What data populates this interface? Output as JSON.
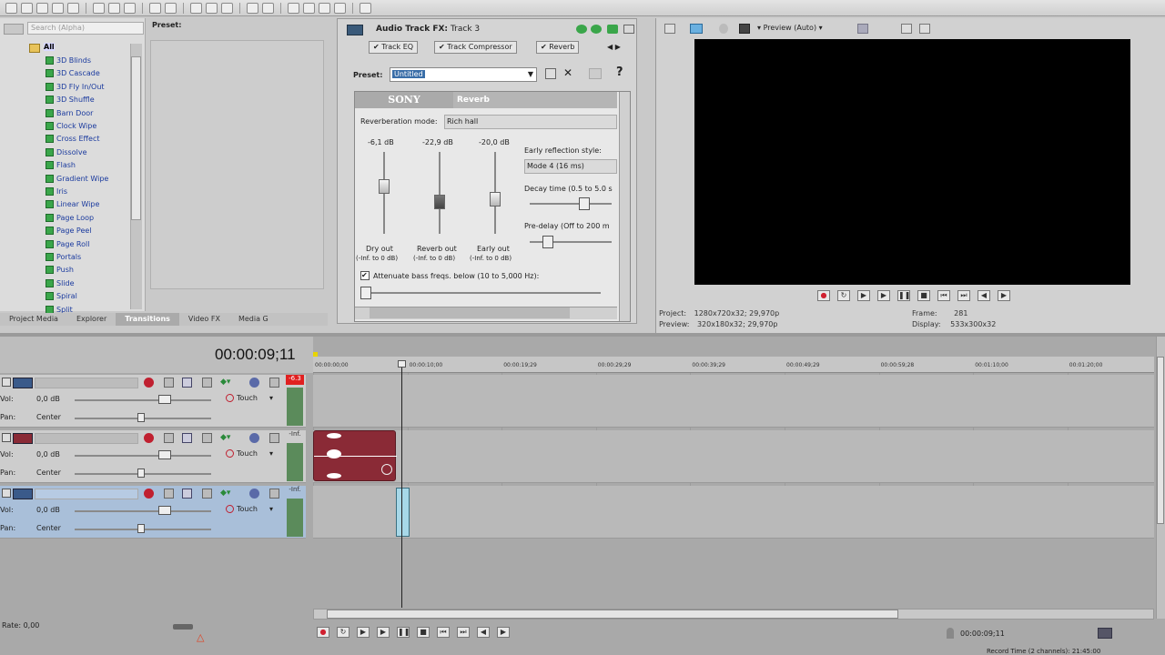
{
  "explorer": {
    "search_placeholder": "Search (Alpha)",
    "preset_label": "Preset:",
    "root_label": "All",
    "items": [
      "3D Blinds",
      "3D Cascade",
      "3D Fly In/Out",
      "3D Shuffle",
      "Barn Door",
      "Clock Wipe",
      "Cross Effect",
      "Dissolve",
      "Flash",
      "Gradient Wipe",
      "Iris",
      "Linear Wipe",
      "Page Loop",
      "Page Peel",
      "Page Roll",
      "Portals",
      "Push",
      "Slide",
      "Spiral",
      "Split"
    ],
    "tabs": [
      "Project Media",
      "Explorer",
      "Transitions",
      "Video FX",
      "Media G"
    ]
  },
  "fx": {
    "title": "Audio Track FX:",
    "track": "Track 3",
    "chain": [
      "Track EQ",
      "Track Compressor",
      "Reverb"
    ],
    "preset_label": "Preset:",
    "preset_value": "Untitled",
    "brand": "SONY",
    "plugin_name": "Reverb",
    "mode_label": "Reverberation mode:",
    "mode_value": "Rich hall",
    "sliders": [
      {
        "value": "-6,1 dB",
        "label": "Dry out",
        "range": "(-Inf. to 0 dB)"
      },
      {
        "value": "-22,9 dB",
        "label": "Reverb out",
        "range": "(-Inf. to 0 dB)"
      },
      {
        "value": "-20,0 dB",
        "label": "Early out",
        "range": "(-Inf. to 0 dB)"
      }
    ],
    "early_style_label": "Early reflection style:",
    "early_style_value": "Mode 4  (16 ms)",
    "decay_label": "Decay time (0.5 to 5.0 s",
    "predelay_label": "Pre-delay (Off to 200 m",
    "attenuate_label": "Attenuate bass freqs. below (10 to 5,000 Hz):"
  },
  "preview": {
    "mode": "Preview (Auto)",
    "project_label": "Project:",
    "project_value": "1280x720x32; 29,970p",
    "preview_label": "Preview:",
    "preview_value": "320x180x32; 29,970p",
    "frame_label": "Frame:",
    "frame_value": "281",
    "display_label": "Display:",
    "display_value": "533x300x32"
  },
  "timeline": {
    "timecode": "00:00:09;11",
    "ruler": [
      "00:00:00;00",
      "00:00:10;00",
      "00:00:19;29",
      "00:00:29;29",
      "00:00:39;29",
      "00:00:49;29",
      "00:00:59;28",
      "00:01:10;00",
      "00:01:20;00"
    ],
    "tracks": [
      {
        "vol_label": "Vol:",
        "vol": "0,0 dB",
        "pan_label": "Pan:",
        "pan": "Center",
        "auto": "Touch",
        "peak": "-6.3"
      },
      {
        "vol_label": "Vol:",
        "vol": "0,0 dB",
        "pan_label": "Pan:",
        "pan": "Center",
        "auto": "Touch",
        "peak": "-Inf."
      },
      {
        "vol_label": "Vol:",
        "vol": "0,0 dB",
        "pan_label": "Pan:",
        "pan": "Center",
        "auto": "Touch",
        "peak": "-Inf."
      }
    ],
    "rate": "Rate: 0,00",
    "bottom_time": "00:00:09;11",
    "status": "Record Time (2 channels): 21:45:00"
  }
}
